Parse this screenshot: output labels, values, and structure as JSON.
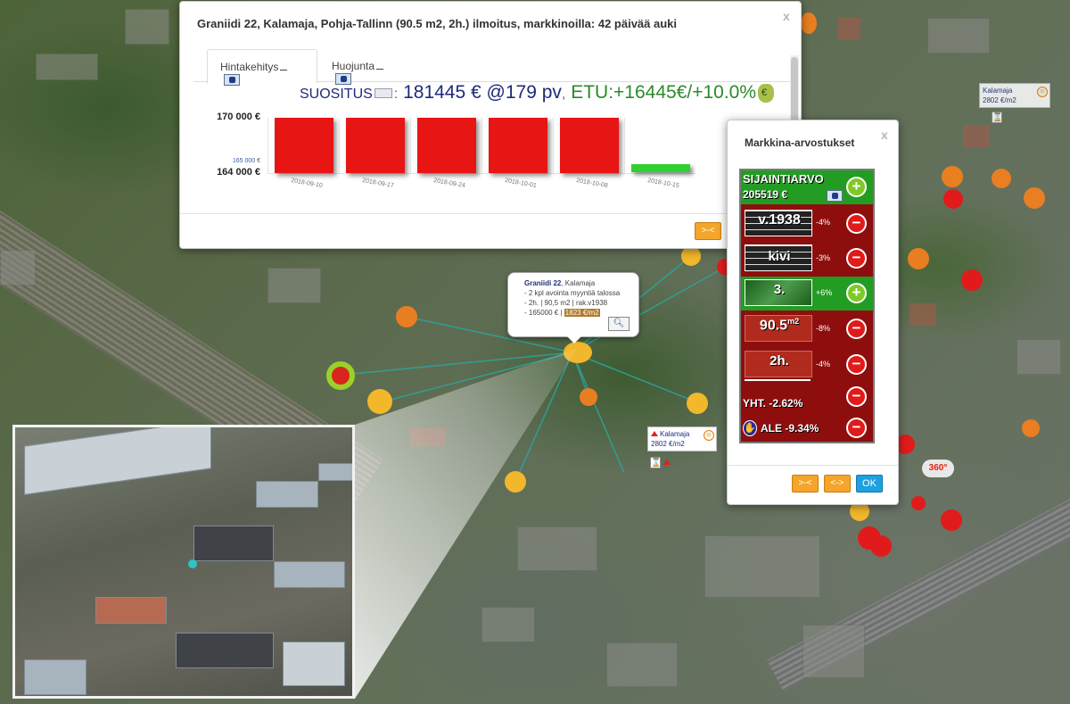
{
  "price_dialog": {
    "title": "Graniidi 22, Kalamaja, Pohja-Tallinn (90.5 m2, 2h.) ilmoitus, markkinoilla: 42 päivää auki",
    "close": "x",
    "tabs": [
      {
        "label": "Hintakehitys",
        "active": true,
        "icon": "print-icon"
      },
      {
        "label": "Huojunta",
        "active": false,
        "icon": "print-icon"
      }
    ],
    "reco_label": "SUOSITUS",
    "reco_value": "181445 € @179 pv",
    "reco_sep": ",",
    "etu": "ETU:+16445€/+10.0%",
    "button": ">-<"
  },
  "chart_data": {
    "type": "bar",
    "categories": [
      "2018-09-10",
      "2018-09-17",
      "2018-09-24",
      "2018-10-01",
      "2018-10-08",
      "2018-10-15"
    ],
    "values": [
      170000,
      170000,
      170000,
      170000,
      170000,
      165000
    ],
    "colors": [
      "#e81515",
      "#e81515",
      "#e81515",
      "#e81515",
      "#e81515",
      "#2fd02f"
    ],
    "yticks": [
      "170 000 €",
      "164 000 €"
    ],
    "ylim": [
      164000,
      170000
    ],
    "marker_label": "165 000 €"
  },
  "market_dialog": {
    "title": "Markkina-arvostukset",
    "close": "x",
    "location": {
      "label": "SIJAINTIARVO",
      "value": "205519 €"
    },
    "factors": [
      {
        "tile": "v.1938",
        "pct": "-4%",
        "sign": "-",
        "kind": "year"
      },
      {
        "tile": "kivi",
        "pct": "-3%",
        "sign": "-",
        "kind": "material"
      },
      {
        "tile": "3.",
        "pct": "+6%",
        "sign": "+",
        "kind": "floor"
      },
      {
        "tile": "90.5",
        "tile_sup": "m2",
        "pct": "-8%",
        "sign": "-",
        "kind": "area"
      },
      {
        "tile": "2h.",
        "pct": "-4%",
        "sign": "-",
        "kind": "rooms"
      }
    ],
    "total": "YHT. -2.62%",
    "discount": "ALE -9.34%",
    "buttons": [
      ">-<",
      "<->",
      "OK"
    ]
  },
  "info_popup": {
    "street": "Graniidi 22",
    "district": ", Kalamaja",
    "line1": "- 2 kpl avointa myyntiä talossa",
    "line2": "- 2h. | 90,5 m2 | rak.v1938",
    "line3_prefix": "- 165000 € |",
    "line3_highlight": "1823 €/m2"
  },
  "map_labels": [
    {
      "name": "Kalamaja",
      "price": "2802 €/m2"
    },
    {
      "name": "Kalamaja",
      "price": "2802 €/m2"
    }
  ],
  "badge": "360°"
}
